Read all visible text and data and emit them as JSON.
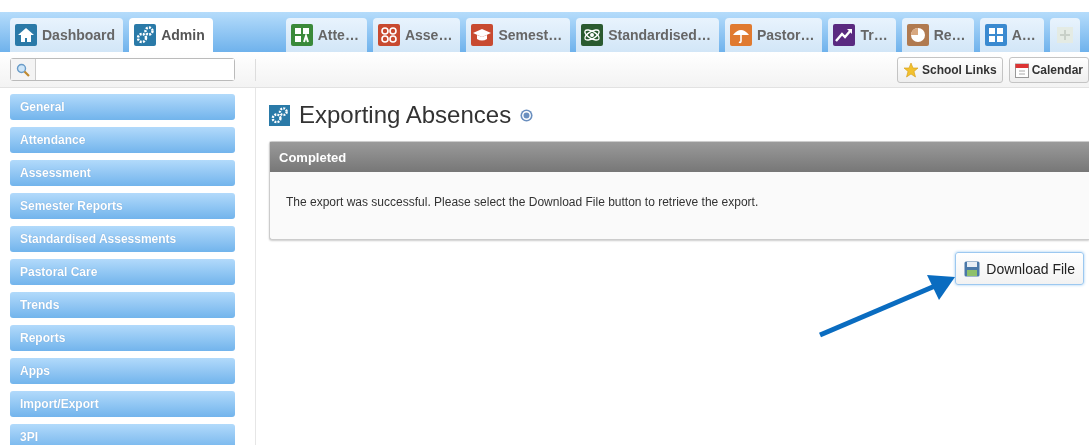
{
  "fixed_tabs": [
    {
      "label": "Dashboard",
      "kind": "home",
      "color": "#2a7aa8",
      "selected": false
    },
    {
      "label": "Admin",
      "kind": "gears",
      "color": "#2a7aa8",
      "selected": true
    }
  ],
  "module_tabs": [
    {
      "label": "Atte…",
      "kind": "checklist",
      "color": "#3a8a3a",
      "selected": false
    },
    {
      "label": "Asse…",
      "kind": "grid-checks",
      "color": "#c84a30",
      "selected": false
    },
    {
      "label": "Semest…",
      "kind": "cap",
      "color": "#c84a30",
      "selected": false
    },
    {
      "label": "Standardised…",
      "kind": "atom",
      "color": "#2a5a30",
      "selected": false
    },
    {
      "label": "Pastor…",
      "kind": "umbrella",
      "color": "#e07a30",
      "selected": false
    },
    {
      "label": "Tr…",
      "kind": "trend",
      "color": "#5a2a80",
      "selected": false
    },
    {
      "label": "Re…",
      "kind": "pie",
      "color": "#b07a50",
      "selected": false
    },
    {
      "label": "A…",
      "kind": "apps",
      "color": "#3a8ad0",
      "selected": false
    }
  ],
  "toolbar_buttons": [
    {
      "label": "School Links",
      "kind": "star"
    },
    {
      "label": "Calendar",
      "kind": "calendar"
    }
  ],
  "sidebar": {
    "items": [
      "General",
      "Attendance",
      "Assessment",
      "Semester Reports",
      "Standardised Assessments",
      "Pastoral Care",
      "Trends",
      "Reports",
      "Apps",
      "Import/Export",
      "3PI"
    ]
  },
  "page_title": "Exporting Absences",
  "panel": {
    "title": "Completed",
    "message": "The export was successful. Please select the Download File button to retrieve the export."
  },
  "download_button": {
    "label": "Download File"
  }
}
